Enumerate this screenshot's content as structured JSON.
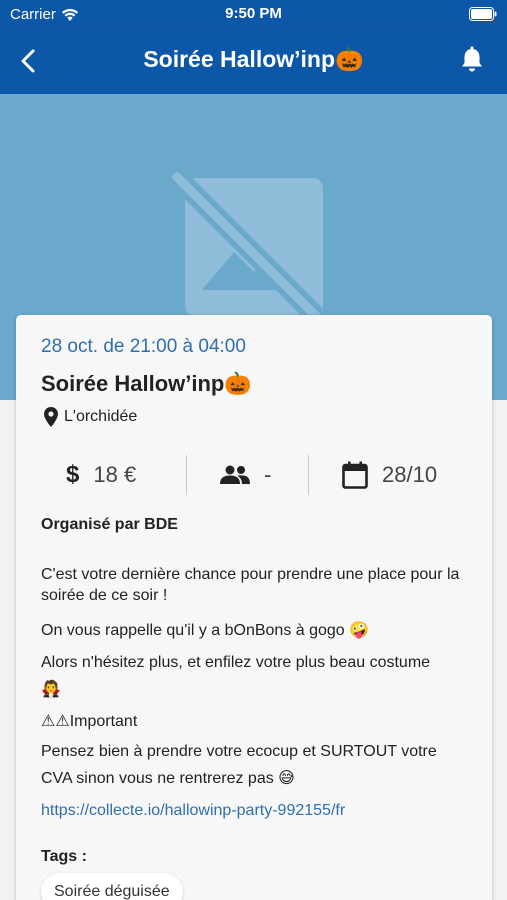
{
  "status_bar": {
    "carrier": "Carrier",
    "time": "9:50 PM"
  },
  "nav": {
    "title": "Soirée Hallow’inp🎃",
    "back_icon": "chevron-left-icon",
    "bell_icon": "bell-icon"
  },
  "hero": {
    "placeholder_icon": "image-off-icon"
  },
  "event": {
    "date": "28 oct. de 21:00 à 04:00",
    "title": "Soirée Hallow’inp🎃",
    "location": "L'orchidée",
    "price": "18 €",
    "participants": "-",
    "day": "28/10",
    "organiser": "Organisé par BDE",
    "description": [
      "C'est votre dernière chance pour prendre une place pour la soirée de ce soir !",
      "On vous rappelle qu'il y a bOnBons à gogo 🤪",
      "Alors n'hésitez plus, et enfilez votre plus beau costume 🧛",
      "⚠⚠Important",
      "Pensez bien à prendre votre ecocup et SURTOUT votre CVA sinon vous ne rentrerez pas 😅"
    ],
    "link": "https://collecte.io/hallowinp-party-992155/fr",
    "tags_label": "Tags :",
    "tags": [
      "Soirée déguisée"
    ]
  },
  "colors": {
    "primary": "#0d57a8",
    "hero": "#6aa9cc",
    "link": "#2f6fad",
    "card": "#f7f7f7"
  }
}
